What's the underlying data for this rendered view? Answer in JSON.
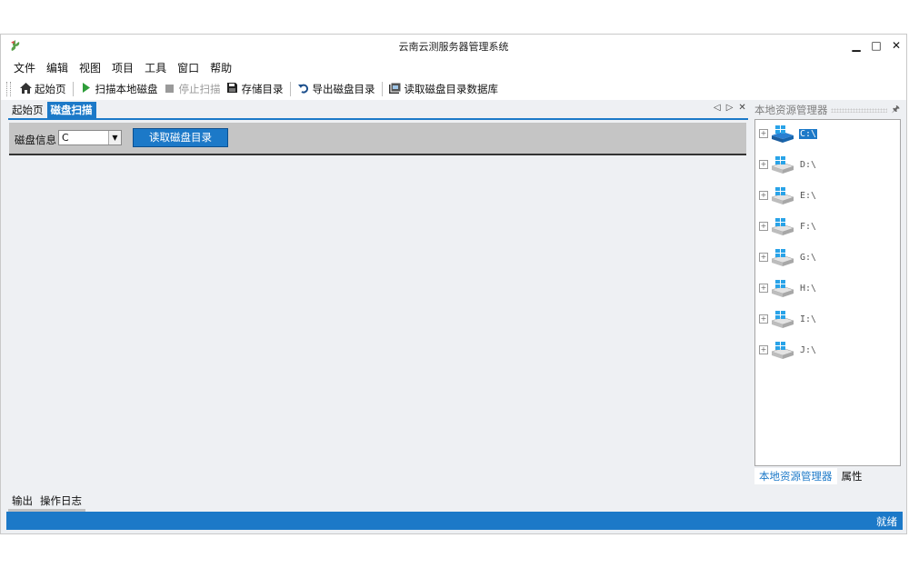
{
  "window": {
    "title": "云南云测服务器管理系统",
    "controls": {
      "minimize": "▁",
      "maximize": "□",
      "close": "✕"
    }
  },
  "menu": [
    "文件",
    "编辑",
    "视图",
    "项目",
    "工具",
    "窗口",
    "帮助"
  ],
  "toolbar": {
    "home": {
      "label": "起始页",
      "icon": "home-icon"
    },
    "scan": {
      "label": "扫描本地磁盘",
      "icon": "play-icon"
    },
    "stop": {
      "label": "停止扫描",
      "icon": "stop-icon",
      "disabled": true
    },
    "save": {
      "label": "存储目录",
      "icon": "save-icon"
    },
    "export": {
      "label": "导出磁盘目录",
      "icon": "undo-icon"
    },
    "read_db": {
      "label": "读取磁盘目录数据库",
      "icon": "database-icon"
    }
  },
  "doc_tabs": [
    {
      "label": "起始页",
      "active": false
    },
    {
      "label": "磁盘扫描",
      "active": true
    }
  ],
  "doc_tab_controls": {
    "prev": "◁",
    "next": "▷",
    "close": "✕"
  },
  "disk_panel": {
    "label": "磁盘信息",
    "selected_disk": "C",
    "read_button": "读取磁盘目录"
  },
  "right_panel": {
    "title": "本地资源管理器",
    "pin": "🖈",
    "drives": [
      "C:\\",
      "D:\\",
      "E:\\",
      "F:\\",
      "G:\\",
      "H:\\",
      "I:\\",
      "J:\\"
    ],
    "selected_drive_index": 0,
    "tabs": [
      {
        "label": "本地资源管理器",
        "active": true
      },
      {
        "label": "属性",
        "active": false
      }
    ]
  },
  "bottom_tabs": [
    "输出",
    "操作日志"
  ],
  "status": {
    "text": "就绪"
  },
  "colors": {
    "accent": "#1c79c8",
    "panel_bg": "#eef0f3",
    "disk_toolbar_bg": "#c5c5c5"
  }
}
